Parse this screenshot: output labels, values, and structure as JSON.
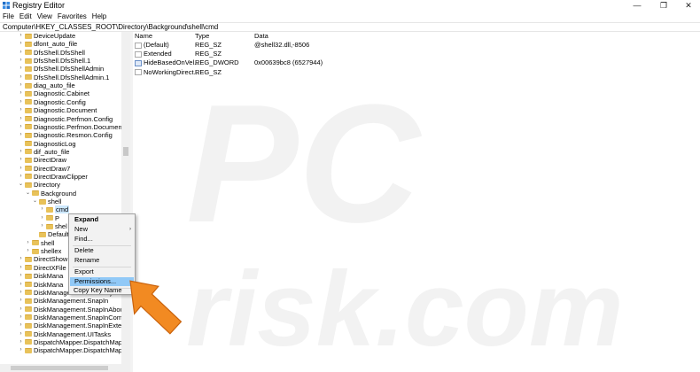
{
  "window": {
    "title": "Registry Editor",
    "minimize": "—",
    "maximize": "❐",
    "close": "✕"
  },
  "menu": [
    "File",
    "Edit",
    "View",
    "Favorites",
    "Help"
  ],
  "address": "Computer\\HKEY_CLASSES_ROOT\\Directory\\Background\\shell\\cmd",
  "tree": [
    {
      "label": "DeviceUpdate",
      "arrow": "›"
    },
    {
      "label": "dfont_auto_file",
      "arrow": "›"
    },
    {
      "label": "DfsShell.DfsShell",
      "arrow": "›"
    },
    {
      "label": "DfsShell.DfsShell.1",
      "arrow": "›"
    },
    {
      "label": "DfsShell.DfsShellAdmin",
      "arrow": "›"
    },
    {
      "label": "DfsShell.DfsShellAdmin.1",
      "arrow": "›"
    },
    {
      "label": "diag_auto_file",
      "arrow": "›"
    },
    {
      "label": "Diagnostic.Cabinet",
      "arrow": "›"
    },
    {
      "label": "Diagnostic.Config",
      "arrow": "›"
    },
    {
      "label": "Diagnostic.Document",
      "arrow": "›"
    },
    {
      "label": "Diagnostic.Perfmon.Config",
      "arrow": "›"
    },
    {
      "label": "Diagnostic.Perfmon.Document",
      "arrow": "›"
    },
    {
      "label": "Diagnostic.Resmon.Config",
      "arrow": "›"
    },
    {
      "label": "DiagnosticLog",
      "arrow": ""
    },
    {
      "label": "dif_auto_file",
      "arrow": "›"
    },
    {
      "label": "DirectDraw",
      "arrow": "›"
    },
    {
      "label": "DirectDraw7",
      "arrow": "›"
    },
    {
      "label": "DirectDrawClipper",
      "arrow": "›"
    },
    {
      "label": "Directory",
      "arrow": "⌄"
    },
    {
      "label": "Background",
      "arrow": "⌄"
    },
    {
      "label": "shell",
      "arrow": "⌄"
    },
    {
      "label": "cmd",
      "arrow": "›"
    },
    {
      "label": "P",
      "arrow": "›"
    },
    {
      "label": "shel",
      "arrow": "›"
    },
    {
      "label": "Default",
      "arrow": ""
    },
    {
      "label": "shell",
      "arrow": "›"
    },
    {
      "label": "shellex",
      "arrow": "›"
    },
    {
      "label": "DirectShow",
      "arrow": "›"
    },
    {
      "label": "DirectXFile",
      "arrow": "›"
    },
    {
      "label": "DiskMana",
      "arrow": "›"
    },
    {
      "label": "DiskMana",
      "arrow": "›"
    },
    {
      "label": "DiskManagement.DataObject",
      "arrow": "›"
    },
    {
      "label": "DiskManagement.SnapIn",
      "arrow": "›"
    },
    {
      "label": "DiskManagement.SnapInAbout",
      "arrow": "›"
    },
    {
      "label": "DiskManagement.SnapInCompor",
      "arrow": "›"
    },
    {
      "label": "DiskManagement.SnapInExtensic",
      "arrow": "›"
    },
    {
      "label": "DiskManagement.UITasks",
      "arrow": "›"
    },
    {
      "label": "DispatchMapper.DispatchMapper",
      "arrow": "›"
    },
    {
      "label": "DispatchMapper.DispatchMapper",
      "arrow": "›"
    }
  ],
  "columns": {
    "name": "Name",
    "type": "Type",
    "data": "Data"
  },
  "values": [
    {
      "name": "(Default)",
      "type": "REG_SZ",
      "data": "@shell32.dll,-8506",
      "kind": "sz"
    },
    {
      "name": "Extended",
      "type": "REG_SZ",
      "data": "",
      "kind": "sz"
    },
    {
      "name": "HideBasedOnVel...",
      "type": "REG_DWORD",
      "data": "0x00639bc8 (6527944)",
      "kind": "dword"
    },
    {
      "name": "NoWorkingDirect...",
      "type": "REG_SZ",
      "data": "",
      "kind": "sz"
    }
  ],
  "context_menu": {
    "expand": "Expand",
    "new": "New",
    "find": "Find...",
    "delete": "Delete",
    "rename": "Rename",
    "export": "Export",
    "permissions": "Permissions...",
    "copy_key_name": "Copy Key Name",
    "submenu_arrow": "›"
  },
  "watermark_text": "PC risk.com",
  "colors": {
    "selection": "#cde8ff",
    "menu_highlight": "#91c9f7",
    "folder": "#e8c25a",
    "arrow_fill": "#f28a22"
  }
}
